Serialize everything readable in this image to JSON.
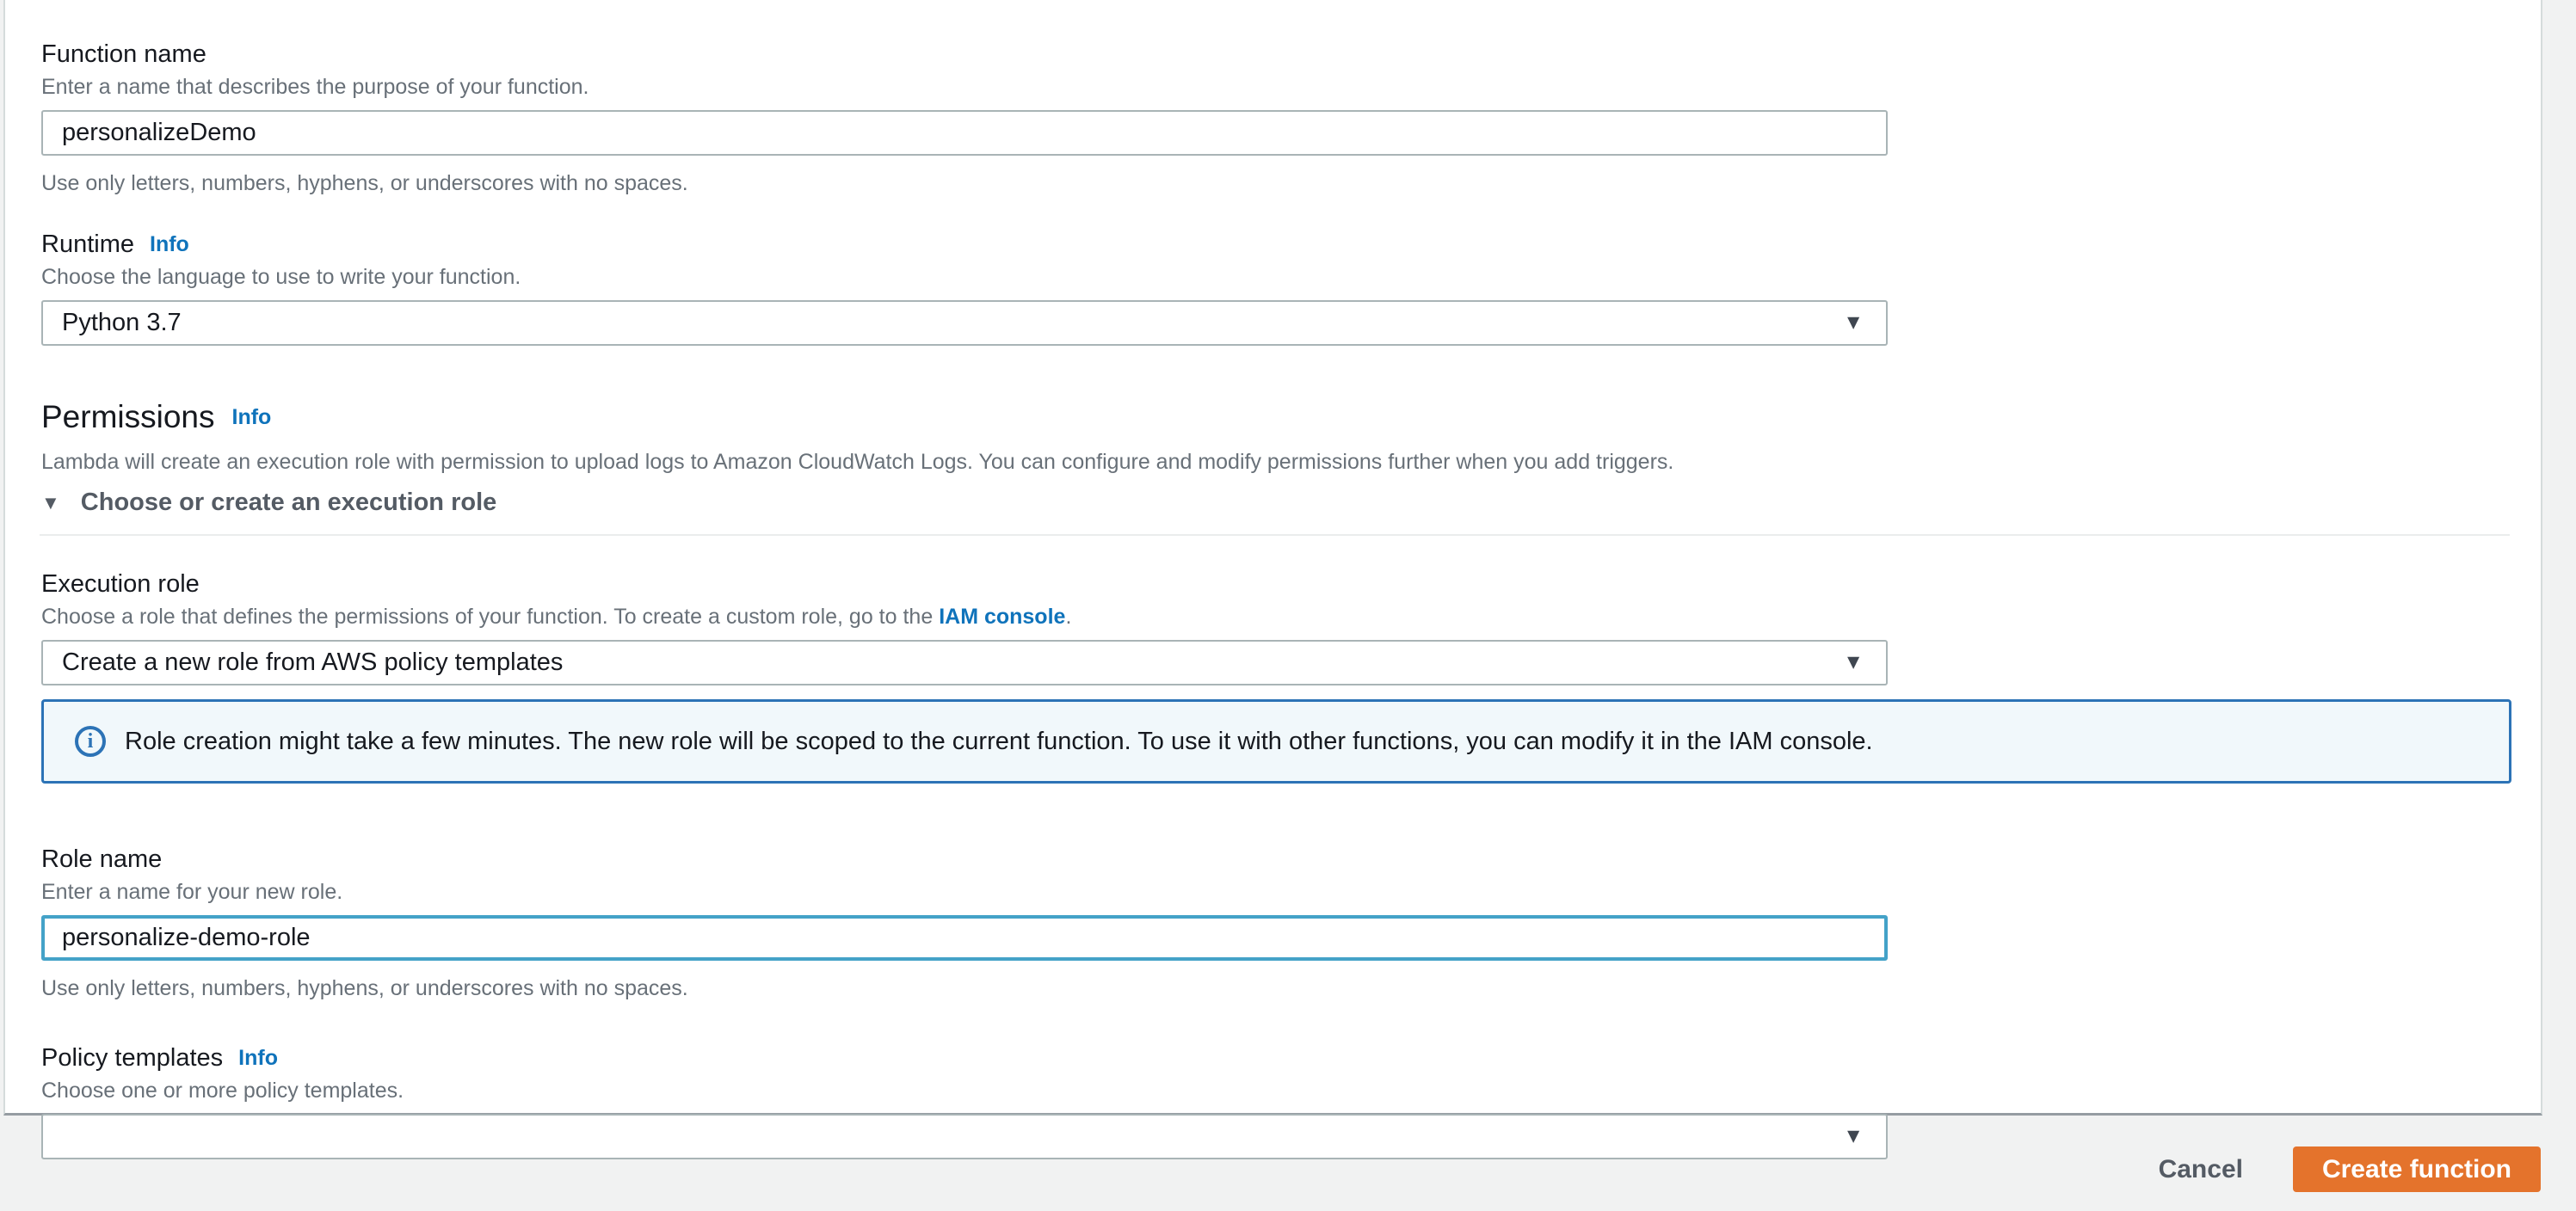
{
  "colors": {
    "accent_orange": "#e4732c",
    "link_blue": "#0f73bb",
    "focus_border": "#44a2c8",
    "alert_border": "#2c73b6",
    "alert_background": "#f1f8fb",
    "page_background": "#f1f2f2"
  },
  "form": {
    "function_name": {
      "label": "Function name",
      "description": "Enter a name that describes the purpose of your function.",
      "value": "personalizeDemo",
      "helper": "Use only letters, numbers, hyphens, or underscores with no spaces."
    },
    "runtime": {
      "label": "Runtime",
      "info_label": "Info",
      "description": "Choose the language to use to write your function.",
      "value": "Python 3.7"
    },
    "permissions": {
      "heading": "Permissions",
      "info_label": "Info",
      "description": "Lambda will create an execution role with permission to upload logs to Amazon CloudWatch Logs. You can configure and modify permissions further when you add triggers.",
      "expander_label": "Choose or create an execution role",
      "expander_caret": "▼"
    },
    "execution_role": {
      "label": "Execution role",
      "description_prefix": "Choose a role that defines the permissions of your function. To create a custom role, go to the ",
      "link_text": "IAM console",
      "description_suffix": ".",
      "value": "Create a new role from AWS policy templates"
    },
    "role_alert": {
      "icon": "i",
      "text": "Role creation might take a few minutes. The new role will be scoped to the current function. To use it with other functions, you can modify it in the IAM console."
    },
    "role_name": {
      "label": "Role name",
      "description": "Enter a name for your new role.",
      "value": "personalize-demo-role",
      "helper": "Use only letters, numbers, hyphens, or underscores with no spaces."
    },
    "policy_templates": {
      "label": "Policy templates",
      "info_label": "Info",
      "description": "Choose one or more policy templates.",
      "value": ""
    },
    "dropdown_arrow": "▼"
  },
  "footer": {
    "cancel_label": "Cancel",
    "create_label": "Create function"
  }
}
